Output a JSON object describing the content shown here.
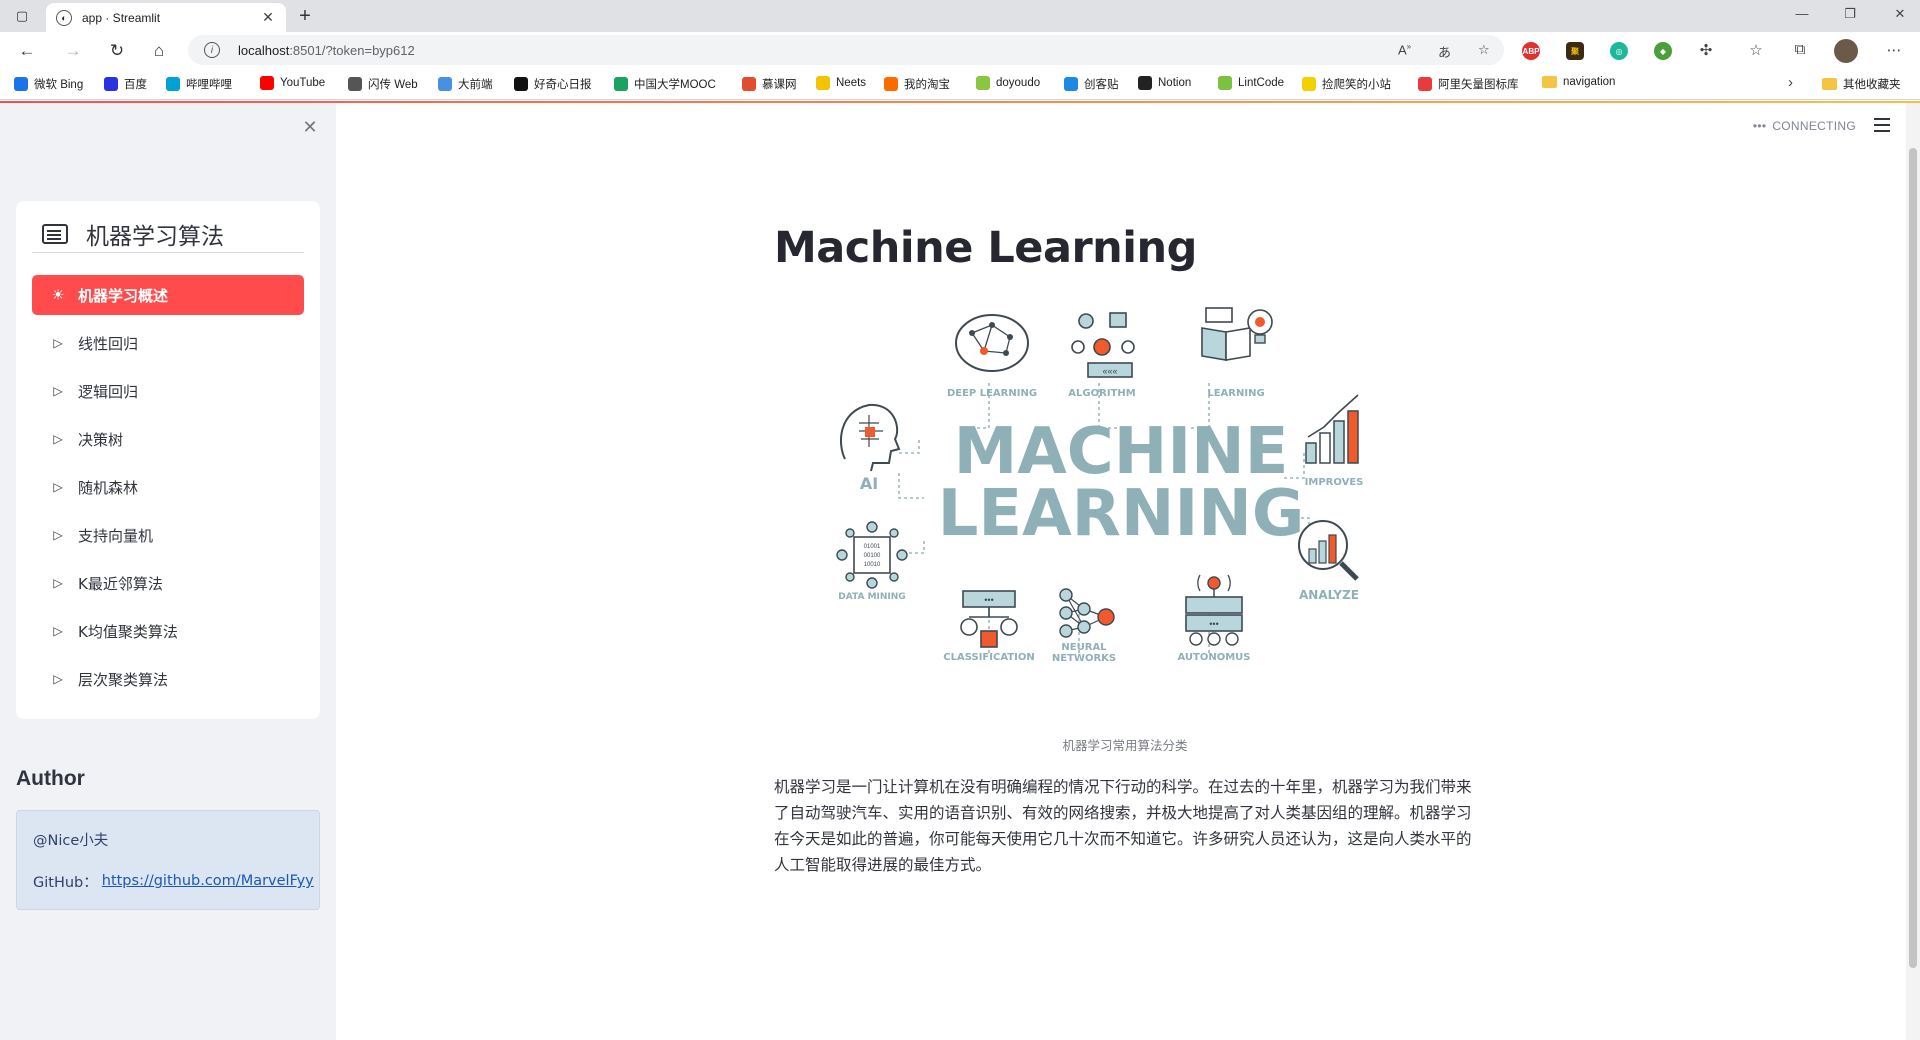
{
  "browser": {
    "tab_title": "app · Streamlit",
    "url_host": "localhost",
    "url_path": ":8501/?token=byp612",
    "bookmarks": [
      {
        "label": "微软 Bing",
        "color": "#1a73e8"
      },
      {
        "label": "百度",
        "color": "#2932e1"
      },
      {
        "label": "哔哩哔哩",
        "color": "#00a1d6"
      },
      {
        "label": "YouTube",
        "color": "#ff0000"
      },
      {
        "label": "闪传 Web",
        "color": "#555555"
      },
      {
        "label": "大前端",
        "color": "#4a90e2"
      },
      {
        "label": "好奇心日报",
        "color": "#111111"
      },
      {
        "label": "中国大学MOOC",
        "color": "#1aa260"
      },
      {
        "label": "慕课网",
        "color": "#e34b2f"
      },
      {
        "label": "Neets",
        "color": "#f2c300"
      },
      {
        "label": "我的淘宝",
        "color": "#ff6a00"
      },
      {
        "label": "doyoudo",
        "color": "#8cc63f"
      },
      {
        "label": "创客贴",
        "color": "#1e88e5"
      },
      {
        "label": "Notion",
        "color": "#222222"
      },
      {
        "label": "LintCode",
        "color": "#7cc241"
      },
      {
        "label": "捡爬笑的小站",
        "color": "#f5d000"
      },
      {
        "label": "阿里矢量图标库",
        "color": "#e93b3b"
      },
      {
        "label": "navigation",
        "color": "#f6c443"
      }
    ],
    "other_bookmarks": "其他收藏夹"
  },
  "sidebar": {
    "menu_title": "机器学习算法",
    "items": [
      {
        "label": "机器学习概述",
        "active": true
      },
      {
        "label": "线性回归",
        "active": false
      },
      {
        "label": "逻辑回归",
        "active": false
      },
      {
        "label": "决策树",
        "active": false
      },
      {
        "label": "随机森林",
        "active": false
      },
      {
        "label": "支持向量机",
        "active": false
      },
      {
        "label": "K最近邻算法",
        "active": false
      },
      {
        "label": "K均值聚类算法",
        "active": false
      },
      {
        "label": "层次聚类算法",
        "active": false
      }
    ],
    "author_heading": "Author",
    "author_name": "@Nice小夫",
    "github_label": "GitHub：",
    "github_link": "https://github.com/MarvelFyy"
  },
  "main": {
    "status": "CONNECTING",
    "title": "Machine Learning",
    "hero": {
      "word1": "MACHINE",
      "word2": "LEARNING",
      "labels": {
        "deep_learning": "DEEP LEARNING",
        "algorithm": "ALGORITHM",
        "learning": "LEARNING",
        "ai": "AI",
        "improves": "IMPROVES",
        "data_mining": "DATA MINING",
        "analyze": "ANALYZE",
        "classification": "CLASSIFICATION",
        "neural_1": "NEURAL",
        "neural_2": "NETWORKS",
        "autonomus": "AUTONOMUS"
      },
      "binary_1": "01001",
      "binary_2": "00100",
      "binary_3": "10010"
    },
    "caption": "机器学习常用算法分类",
    "paragraph": "机器学习是一门让计算机在没有明确编程的情况下行动的科学。在过去的十年里，机器学习为我们带来了自动驾驶汽车、实用的语音识别、有效的网络搜索，并极大地提高了对人类基因组的理解。机器学习在今天是如此的普遍，你可能每天使用它几十次而不知道它。许多研究人员还认为，这是向人类水平的人工智能取得进展的最佳方式。"
  },
  "colors": {
    "accent": "#ff4b4b",
    "hero_teal": "#8fb0b6",
    "hero_dark": "#3e4a52",
    "hero_orange": "#f15a2b",
    "hero_light": "#b9d6dd"
  }
}
